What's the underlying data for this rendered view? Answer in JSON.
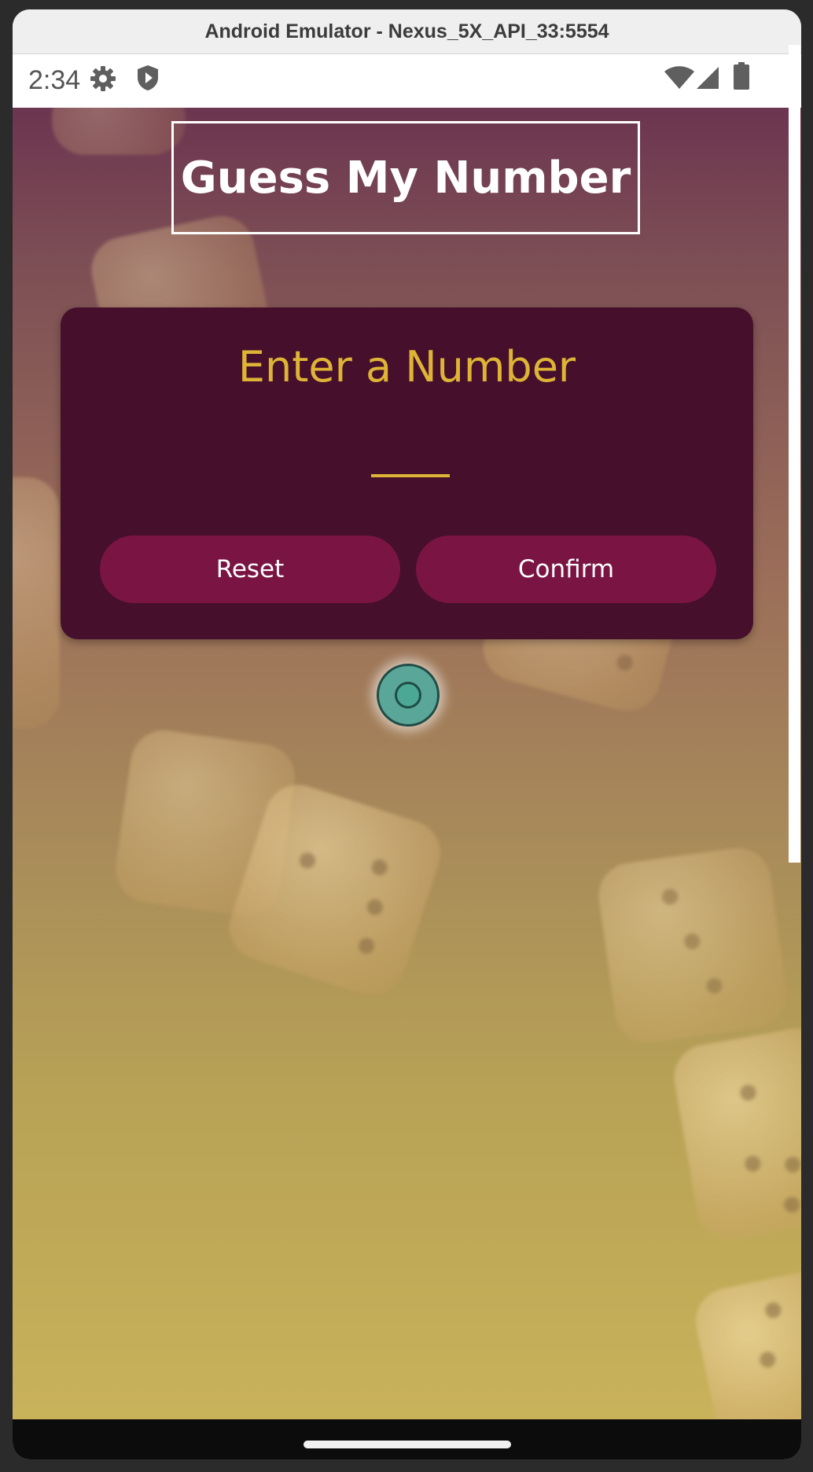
{
  "window": {
    "title": "Android Emulator - Nexus_5X_API_33:5554"
  },
  "status_bar": {
    "time": "2:34",
    "left_icons": [
      "gear-icon",
      "shield-play-icon"
    ],
    "right_icons": [
      "wifi-icon",
      "cellular-signal-icon",
      "battery-icon"
    ]
  },
  "app": {
    "title": "Guess My Number",
    "card": {
      "label": "Enter a Number",
      "input_value": "",
      "reset_label": "Reset",
      "confirm_label": "Confirm"
    }
  },
  "colors": {
    "accent": "#ddb436",
    "card_background": "#460f2c",
    "button_background": "#7a1443",
    "gradient_top": "#6c3550",
    "gradient_bottom": "#c9b25a"
  }
}
